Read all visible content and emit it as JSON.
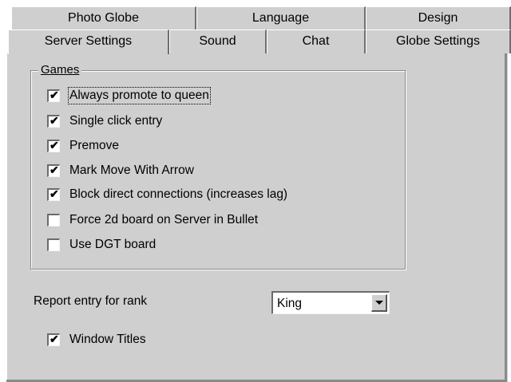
{
  "tabs": {
    "back": [
      "Photo Globe",
      "Language",
      "Design"
    ],
    "front": [
      "Server Settings",
      "Sound",
      "Chat",
      "Globe Settings"
    ],
    "active": "Server Settings"
  },
  "games": {
    "legend_accel": "G",
    "legend_rest": "ames",
    "options": [
      {
        "label": "Always promote to queen",
        "checked": true
      },
      {
        "label": "Single click entry",
        "checked": true
      },
      {
        "label": "Premove",
        "checked": true
      },
      {
        "label": "Mark Move With Arrow",
        "checked": true
      },
      {
        "label": "Block direct connections (increases lag)",
        "checked": true
      },
      {
        "label": "Force 2d board on Server in Bullet",
        "checked": false
      },
      {
        "label": "Use DGT board",
        "checked": false
      }
    ]
  },
  "rank": {
    "label": "Report entry for rank",
    "value": "King"
  },
  "window_titles": {
    "label": "Window Titles",
    "checked": true
  },
  "check_glyph": "✔"
}
